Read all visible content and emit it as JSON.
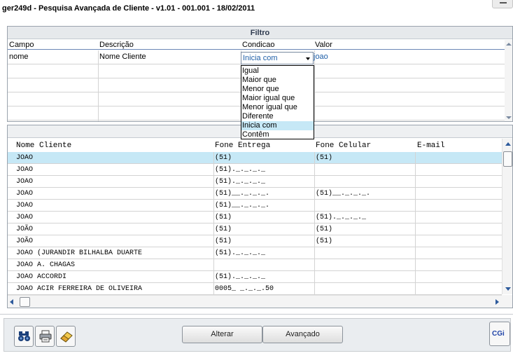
{
  "window": {
    "title": "ger249d - Pesquisa Avançada de Cliente - v1.01 - 001.001 - 18/02/2011"
  },
  "filter": {
    "header": "Filtro",
    "columns": [
      "Campo",
      "Descrição",
      "Condicao",
      "Valor"
    ],
    "row": {
      "campo": "nome",
      "descricao": "Nome Cliente",
      "condicao": "Inicia com",
      "valor": "joao"
    },
    "condition_options": [
      "Igual",
      "Maior que",
      "Menor que",
      "Maior igual que",
      "Menor igual que",
      "Diferente",
      "Inicia com",
      "Contêm"
    ],
    "selected_option": "Inicia com"
  },
  "results": {
    "columns": [
      "Nome Cliente",
      "Fone Entrega",
      "Fone Celular",
      "E-mail"
    ],
    "rows": [
      {
        "nome": "JOAO",
        "fone_entrega": "(51)",
        "fone_celular": "(51)",
        "email": ""
      },
      {
        "nome": "JOAO",
        "fone_entrega": "(51)._._._._",
        "fone_celular": "",
        "email": ""
      },
      {
        "nome": "JOAO",
        "fone_entrega": "(51)._._._._",
        "fone_celular": "",
        "email": ""
      },
      {
        "nome": "JOAO",
        "fone_entrega": "(51)__._._._.",
        "fone_celular": "(51)__._._._.",
        "email": ""
      },
      {
        "nome": "JOAO",
        "fone_entrega": "(51)__._._._.",
        "fone_celular": "",
        "email": ""
      },
      {
        "nome": "JOAO",
        "fone_entrega": "(51)",
        "fone_celular": "(51)._._._._",
        "email": ""
      },
      {
        "nome": "JOÃO",
        "fone_entrega": "(51)",
        "fone_celular": "(51)",
        "email": ""
      },
      {
        "nome": "JOÃO",
        "fone_entrega": "(51)",
        "fone_celular": "(51)",
        "email": ""
      },
      {
        "nome": "JOAO (JURANDIR BILHALBA DUARTE",
        "fone_entrega": "(51)._._._._",
        "fone_celular": "",
        "email": ""
      },
      {
        "nome": "JOAO A. CHAGAS",
        "fone_entrega": "",
        "fone_celular": "",
        "email": ""
      },
      {
        "nome": "JOAO ACCORDI",
        "fone_entrega": "(51)._._._._",
        "fone_celular": "",
        "email": ""
      },
      {
        "nome": "JOAO ACIR FERREIRA DE OLIVEIRA",
        "fone_entrega": "0005_ _._._.50",
        "fone_celular": "",
        "email": ""
      }
    ],
    "selected_row": 0
  },
  "toolbar": {
    "icons": [
      "binoculars-icon",
      "printer-icon",
      "eraser-icon"
    ],
    "alterar_label": "Alterar",
    "avancado_label": "Avançado",
    "cgi_label": "CGi"
  },
  "colors": {
    "selection": "#c6e8f6",
    "link_text": "#1f5fa8",
    "brand_blue": "#2144a8"
  }
}
